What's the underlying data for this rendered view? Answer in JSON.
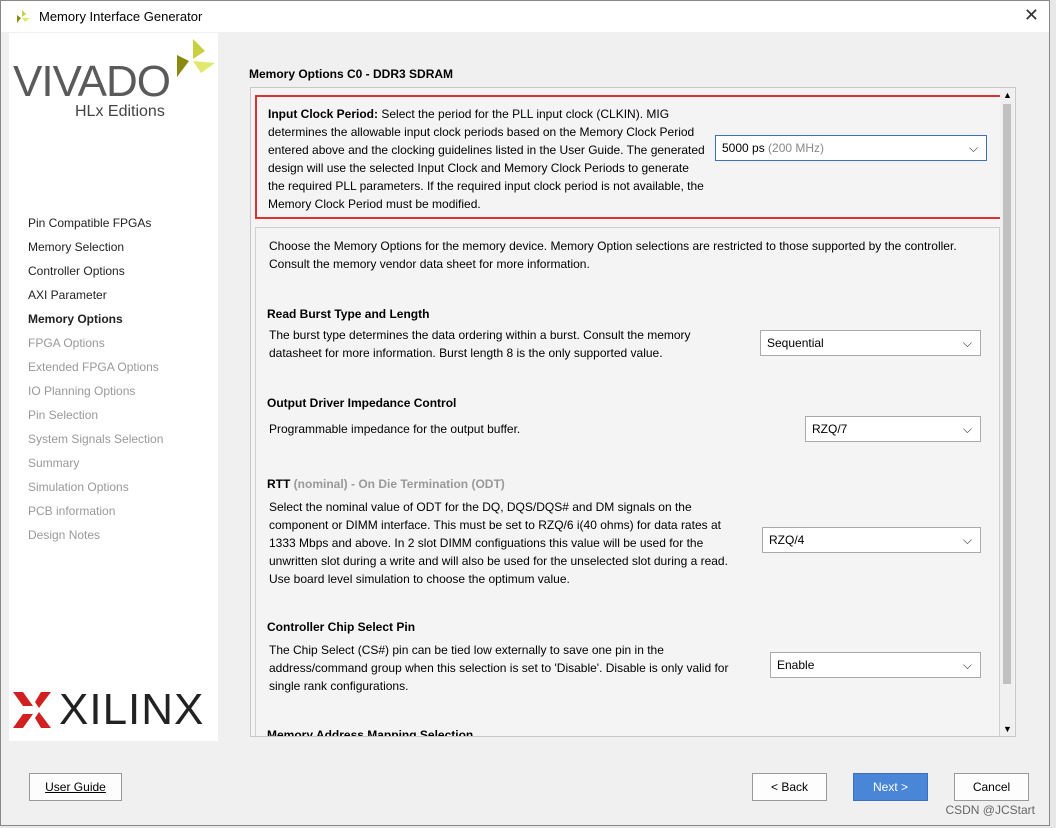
{
  "window": {
    "title": "Memory Interface Generator",
    "close": "✕"
  },
  "logo": {
    "vivado": "VIVADO",
    "edition": "HLx Editions",
    "xilinx": "XILINX"
  },
  "steps": [
    {
      "label": "Pin Compatible FPGAs",
      "state": "done"
    },
    {
      "label": "Memory Selection",
      "state": "done"
    },
    {
      "label": "Controller Options",
      "state": "done"
    },
    {
      "label": "AXI Parameter",
      "state": "done"
    },
    {
      "label": "Memory Options",
      "state": "current"
    },
    {
      "label": "FPGA Options",
      "state": "pending"
    },
    {
      "label": "Extended FPGA Options",
      "state": "pending"
    },
    {
      "label": "IO Planning Options",
      "state": "pending"
    },
    {
      "label": "Pin Selection",
      "state": "pending"
    },
    {
      "label": "System Signals Selection",
      "state": "pending"
    },
    {
      "label": "Summary",
      "state": "pending"
    },
    {
      "label": "Simulation Options",
      "state": "pending"
    },
    {
      "label": "PCB information",
      "state": "pending"
    },
    {
      "label": "Design Notes",
      "state": "pending"
    }
  ],
  "main": {
    "heading": "Memory Options C0 - DDR3 SDRAM",
    "input_clock": {
      "label": "Input Clock Period:",
      "text": "Select the period for the PLL input clock (CLKIN). MIG determines the allowable input clock periods based on the Memory Clock Period entered above and the clocking guidelines listed in the User Guide. The generated design will use the selected Input Clock and Memory Clock Periods to generate the required PLL parameters. If the required input clock period is not available, the Memory Clock Period must be modified.",
      "value": "5000 ps",
      "value_hint": "(200 MHz)"
    },
    "intro": "Choose the Memory Options for the memory device. Memory Option selections are restricted to those supported by the controller. Consult the memory vendor data sheet for more information.",
    "burst": {
      "title": "Read Burst Type and Length",
      "text": "The burst type determines the data ordering within a burst. Consult the memory datasheet for more information. Burst length 8 is the only supported value.",
      "value": "Sequential"
    },
    "odi": {
      "title": "Output Driver Impedance Control",
      "text": "Programmable impedance for the output buffer.",
      "value": "RZQ/7"
    },
    "rtt": {
      "title": "RTT",
      "title_rest": " (nominal) - On Die Termination (ODT)",
      "text": "Select the nominal value of ODT for the DQ, DQS/DQS# and DM signals on the component or DIMM interface. This must be set to RZQ/6 i(40 ohms) for data rates at 1333 Mbps and above. In 2 slot DIMM configuations this value will be used for the unwritten slot during a write and will also be used for the unselected slot during a read. Use board level simulation to choose the optimum value.",
      "value": "RZQ/4"
    },
    "cs": {
      "title": "Controller Chip Select Pin",
      "text": "The Chip Select (CS#) pin can be tied low externally to save one pin in the address/command group when this selection is set to 'Disable'. Disable is only valid for single rank configurations.",
      "value": "Enable"
    },
    "next_section": "Memory Address Mapping Selection"
  },
  "buttons": {
    "user_guide": "User Guide",
    "back": "< Back",
    "next": "Next >",
    "cancel": "Cancel"
  },
  "watermark": "CSDN @JCStart",
  "colors": {
    "highlight": "#e03030",
    "primary": "#4a86d8"
  }
}
